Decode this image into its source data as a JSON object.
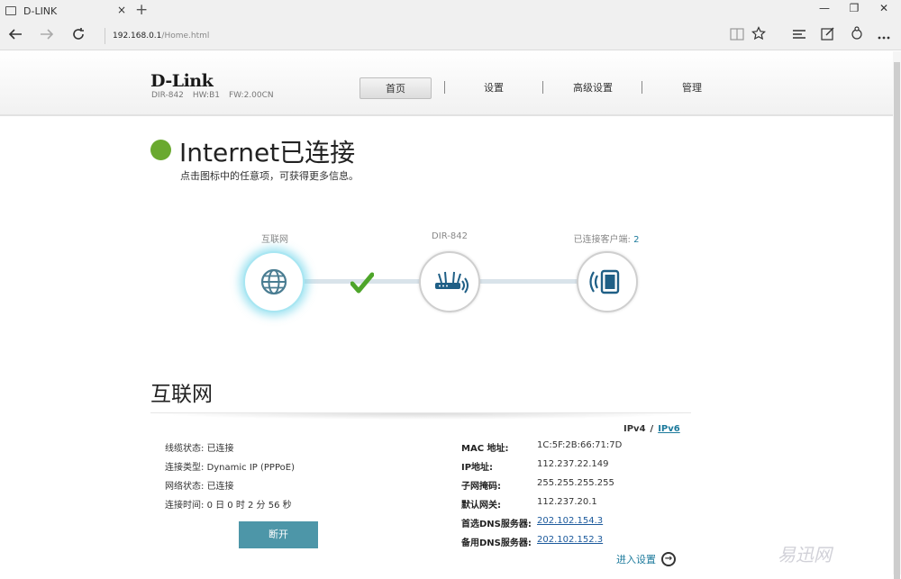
{
  "browser": {
    "tab_title": "D-LINK",
    "tab_close": "×",
    "new_tab": "+",
    "url_host": "192.168.0.1",
    "url_path": "/Home.html",
    "window_controls": {
      "minimize": "—",
      "restore": "❐",
      "close": "✕"
    },
    "icons": [
      "back-icon",
      "forward-icon",
      "refresh-icon",
      "reading-view-icon",
      "favorite-star-icon",
      "hub-icon",
      "web-note-icon",
      "share-icon",
      "more-icon"
    ]
  },
  "header": {
    "logo": "D-Link",
    "model": "DIR-842",
    "hw": "HW:B1",
    "fw": "FW:2.00CN",
    "menu": [
      {
        "label": "首页",
        "active": true
      },
      {
        "label": "设置",
        "active": false
      },
      {
        "label": "高级设置",
        "active": false
      },
      {
        "label": "管理",
        "active": false
      }
    ]
  },
  "status": {
    "title": "Internet已连接",
    "subtitle": "点击图标中的任意项，可获得更多信息。",
    "color": "#6aa92f"
  },
  "topology": {
    "internet_label": "互联网",
    "router_label": "DIR-842",
    "clients_label": "已连接客户端:",
    "clients_count": "2"
  },
  "internet": {
    "section_title": "互联网",
    "ip_tabs": {
      "ipv4": "IPv4",
      "sep": "/",
      "ipv6": "IPv6"
    },
    "left": [
      {
        "label": "线缆状态:",
        "value": "已连接"
      },
      {
        "label": "连接类型:",
        "value": "Dynamic IP (PPPoE)"
      },
      {
        "label": "网络状态:",
        "value": "已连接"
      },
      {
        "label": "连接时间:",
        "value": "0 日 0 时 2 分 56 秒"
      }
    ],
    "right": [
      {
        "label": "MAC 地址:",
        "value": "1C:5F:2B:66:71:7D",
        "link": false
      },
      {
        "label": "IP地址:",
        "value": "112.237.22.149",
        "link": false
      },
      {
        "label": "子网掩码:",
        "value": "255.255.255.255",
        "link": false
      },
      {
        "label": "默认网关:",
        "value": "112.237.20.1",
        "link": false
      },
      {
        "label": "首选DNS服务器:",
        "value": "202.102.154.3",
        "link": true
      },
      {
        "label": "备用DNS服务器:",
        "value": "202.102.152.3",
        "link": true
      }
    ],
    "disconnect_label": "断开",
    "goto_setup_label": "进入设置"
  },
  "watermark": "易迅网",
  "colors": {
    "accent": "#1c7a9c",
    "button": "#4d96a8",
    "connected": "#6aa92f",
    "check": "#4ea52a"
  }
}
